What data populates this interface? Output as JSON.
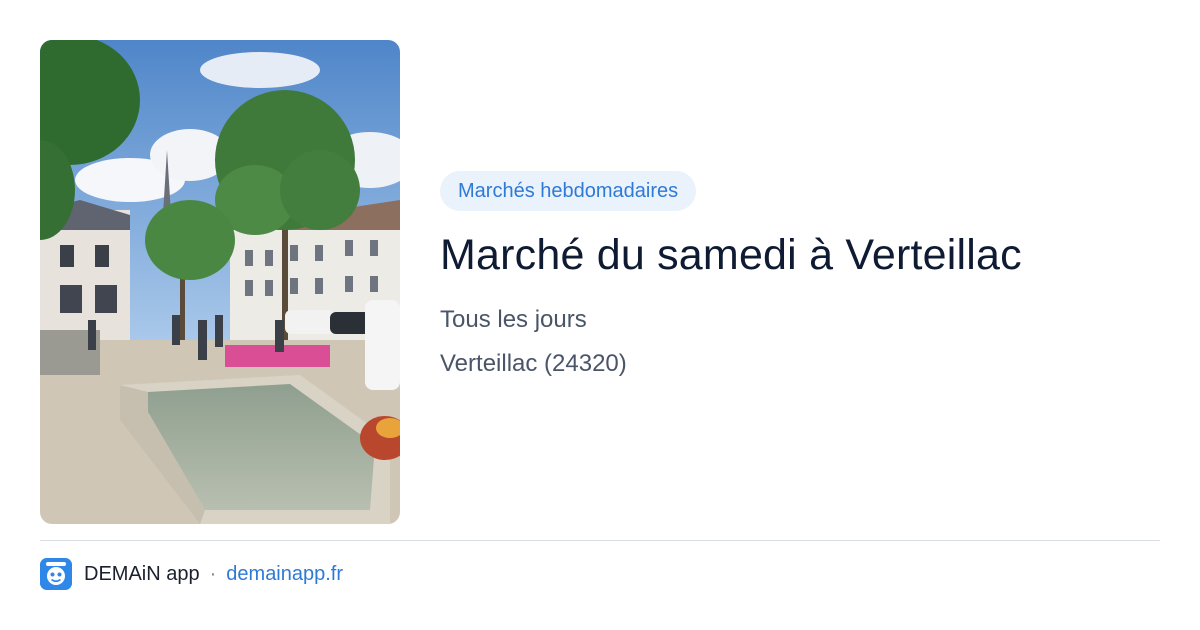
{
  "card": {
    "category": "Marchés hebdomadaires",
    "title": "Marché du samedi à Verteillac",
    "schedule": "Tous les jours",
    "location": "Verteillac (24320)"
  },
  "footer": {
    "app_name": "DEMAiN app",
    "separator": "·",
    "site": "demainapp.fr"
  },
  "colors": {
    "badge_bg": "#eaf2fc",
    "accent": "#2f7ad6",
    "app_icon": "#2f87e8"
  },
  "icons": {
    "app": "app-logo-icon"
  }
}
